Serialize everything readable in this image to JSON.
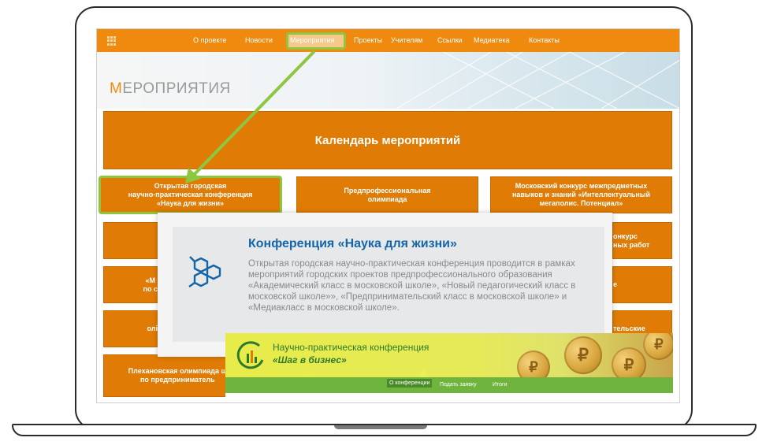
{
  "nav": {
    "items": [
      "О проекте",
      "Новости",
      "Мероприятия",
      "Проекты",
      "Учителям",
      "Ссылки",
      "Медиатека",
      "Контакты"
    ],
    "active": "Мероприятия"
  },
  "page": {
    "title_first": "М",
    "title_rest": "ЕРОПРИЯТИЯ"
  },
  "calendar_button": "Календарь мероприятий",
  "tiles": {
    "conf": "Открытая городская\nнаучно-практическая конференция\n«Наука для жизни»",
    "olymp": "Предпрофессиональная\nолимпиада",
    "mosc": "Московский конкурс межпредметных\nнавыков и знаний «Интеллектуальный\nмегаполис. Потенциал»",
    "r2_right": "онкурс\nных работ",
    "r3_left": "«М\nпо с",
    "r3_right": "е",
    "r4_left": "олі",
    "r4_right": "тельские",
    "r5_left": "Плехановская олимпиада ш\nпо предприниматель"
  },
  "card": {
    "title": "Конференция «Наука для жизни»",
    "text": "Открытая городская научно-практическая конференция проводится в рамках мероприятий городских проектов предпрофессионального образования «Академический класс в московской школе», «Новый педагогический класс в московской школе»», «Предпринимательский класс в московской школе» и «Медиакласс в московской школе»."
  },
  "biz": {
    "line1": "Научно-практическая конференция",
    "line2": "«Шаг в бизнес»",
    "nav": [
      "О конференции",
      "Подать заявку",
      "Итоги"
    ]
  },
  "colors": {
    "orange": "#f08a0e",
    "tile_orange": "#e07b06",
    "highlight_green": "#8dc63f",
    "title_blue": "#1565a8",
    "biz_green": "#6fb43c"
  },
  "icons": [
    "grid-icon",
    "hexagon-molecule-icon",
    "growth-chart-logo-icon",
    "ruble-coin-icon"
  ]
}
